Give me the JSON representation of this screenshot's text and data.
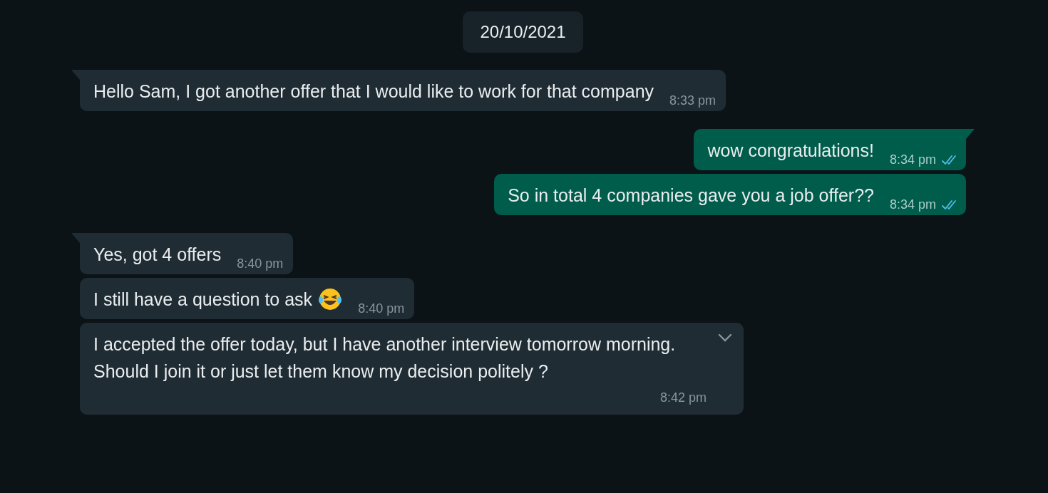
{
  "date_chip": "20/10/2021",
  "messages": [
    {
      "kind": "in",
      "tail": true,
      "text": "Hello Sam, I got another offer that I would like to work for that company",
      "time": "8:33 pm"
    },
    {
      "kind": "out",
      "tail": true,
      "text": "wow congratulations!",
      "time": "8:34 pm",
      "read": true
    },
    {
      "kind": "out",
      "tail": false,
      "text": "So in total 4 companies gave you a job offer??",
      "time": "8:34 pm",
      "read": true
    },
    {
      "kind": "in",
      "tail": true,
      "text": "Yes, got 4 offers",
      "time": "8:40 pm"
    },
    {
      "kind": "in",
      "tail": false,
      "text": "I still have a question to ask",
      "has_emoji": true,
      "time": "8:40 pm"
    },
    {
      "kind": "in",
      "tail": false,
      "text": "I accepted the offer today, but I have another interview tomorrow morning. Should I join it or just let them know my decision politely ?",
      "time": "8:42 pm",
      "menu_open": true
    }
  ]
}
